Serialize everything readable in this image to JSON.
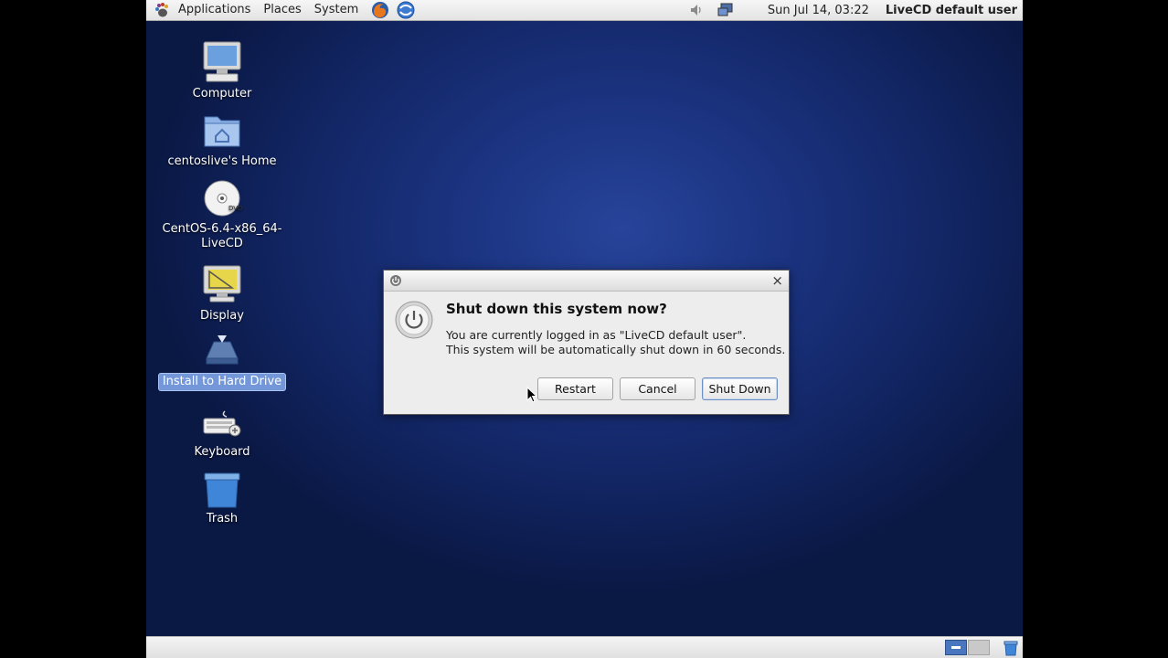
{
  "top_panel": {
    "menus": [
      "Applications",
      "Places",
      "System"
    ],
    "clock": "Sun Jul 14, 03:22",
    "user": "LiveCD default user"
  },
  "desktop": {
    "icons": [
      {
        "label": "Computer",
        "icon": "computer-icon"
      },
      {
        "label": "centoslive's Home",
        "icon": "home-folder-icon"
      },
      {
        "label_line1": "CentOS-6.4-x86_64-",
        "label_line2": "LiveCD",
        "icon": "dvd-icon"
      },
      {
        "label": "Display",
        "icon": "display-icon"
      },
      {
        "label": "Install to Hard Drive",
        "icon": "install-icon",
        "selected": true
      },
      {
        "label": "Keyboard",
        "icon": "keyboard-icon"
      },
      {
        "label": "Trash",
        "icon": "trash-icon"
      }
    ]
  },
  "dialog": {
    "heading": "Shut down this system now?",
    "message_line1": "You are currently logged in as \"LiveCD default user\".",
    "message_line2": "This system will be automatically shut down in 60 seconds.",
    "close_label": "×",
    "buttons": {
      "restart": "Restart",
      "cancel": "Cancel",
      "shutdown": "Shut Down"
    }
  },
  "colors": {
    "desktop_bg": "#1b3380",
    "selection": "#7397d8",
    "workspace_active": "#4a76c0"
  }
}
